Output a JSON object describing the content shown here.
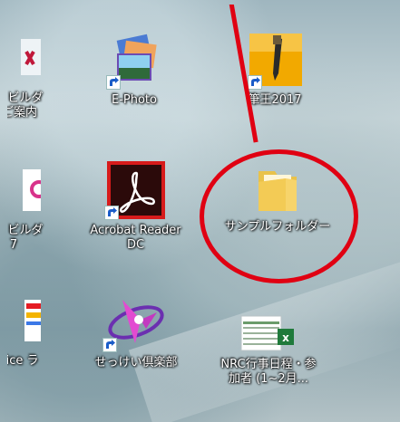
{
  "desktop": {
    "icons": [
      {
        "id": "leftcut-1",
        "label_line1": "ジ・ビルダ",
        "label_line2": "のご案内"
      },
      {
        "id": "ephoto",
        "label_line1": "E-Photo",
        "label_line2": ""
      },
      {
        "id": "hikkei",
        "label_line1": "筆王2017",
        "label_line2": ""
      },
      {
        "id": "leftcut-2",
        "label_line1": "ジ・ビルダ",
        "label_line2": "7"
      },
      {
        "id": "acrobat",
        "label_line1": "Acrobat Reader",
        "label_line2": "DC"
      },
      {
        "id": "sample-folder",
        "label_line1": "サンプルフォルダー",
        "label_line2": ""
      },
      {
        "id": "leftcut-3",
        "label_line1": "Office ラ",
        "label_line2": ""
      },
      {
        "id": "sekkei",
        "label_line1": "せっけい倶楽部",
        "label_line2": ""
      },
      {
        "id": "nrc",
        "label_line1": "NRC行事日程・参",
        "label_line2": "加者 (1~2月..."
      }
    ],
    "highlight_color": "#e00012"
  }
}
